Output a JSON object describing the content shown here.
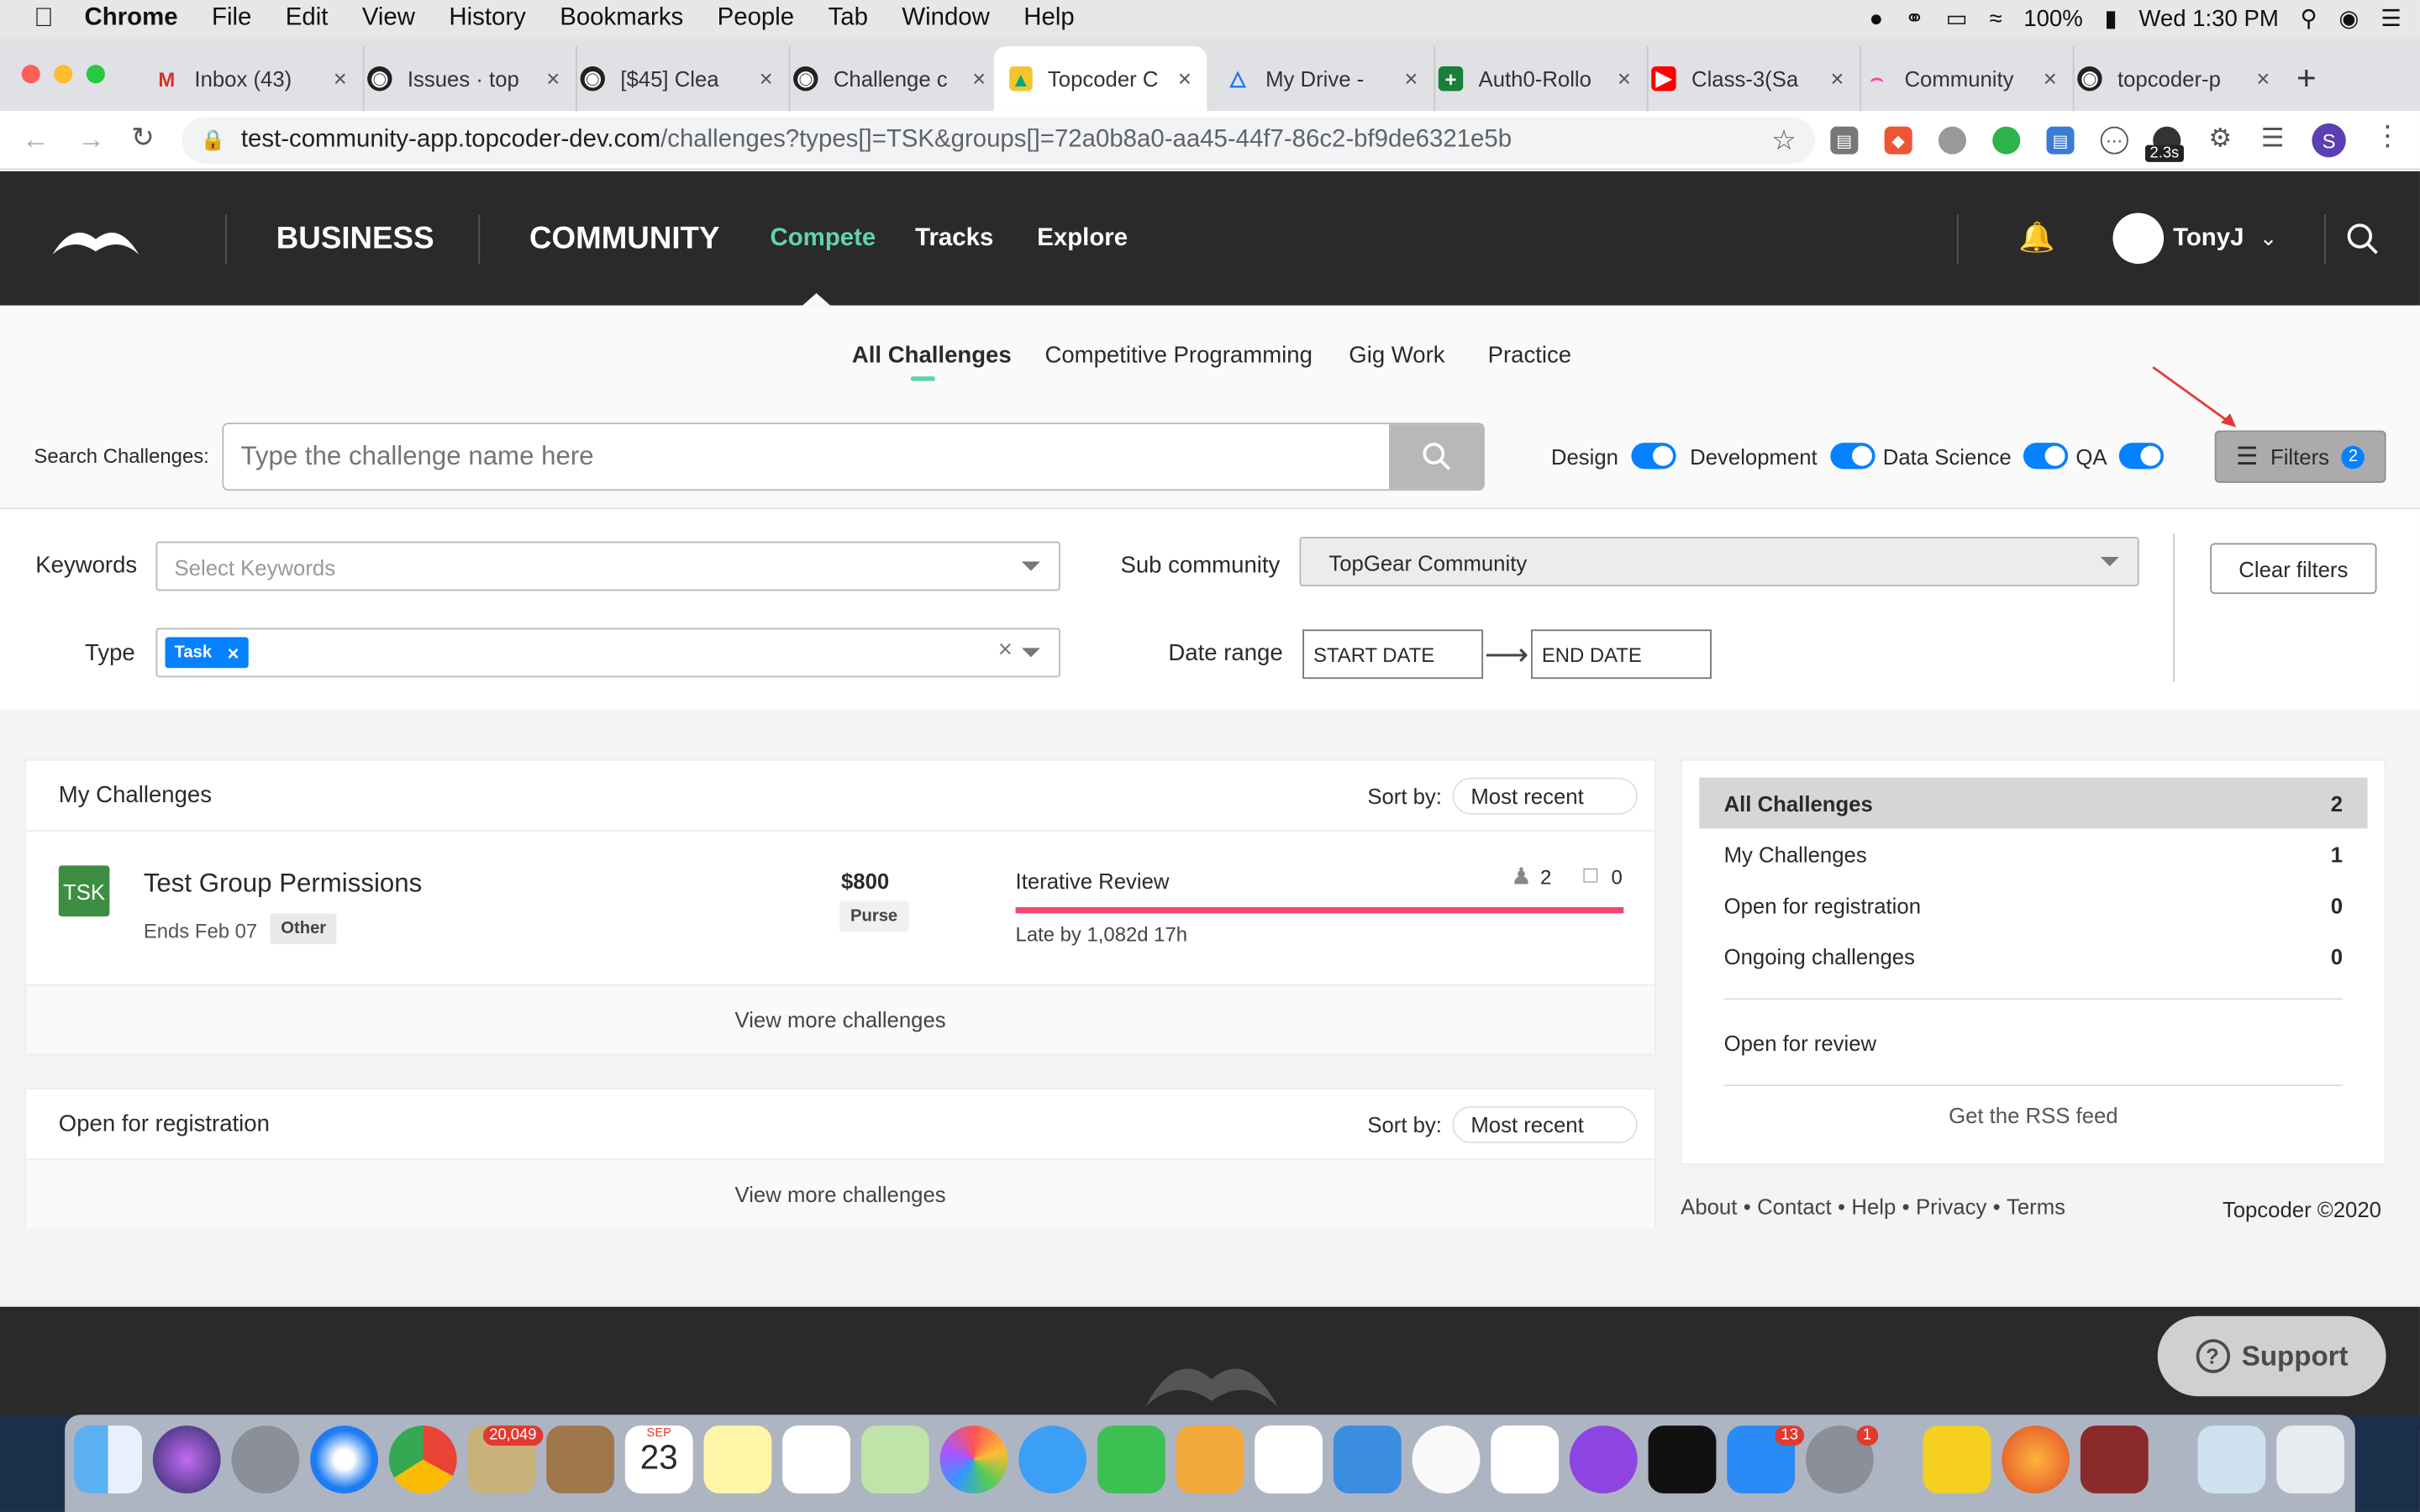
{
  "menubar": {
    "app": "Chrome",
    "items": [
      "File",
      "Edit",
      "View",
      "History",
      "Bookmarks",
      "People",
      "Tab",
      "Window",
      "Help"
    ],
    "battery": "100%",
    "clock": "Wed 1:30 PM"
  },
  "tabs": [
    {
      "label": "Inbox (43)",
      "icon": "gmail-icon"
    },
    {
      "label": "Issues · top",
      "icon": "github-icon"
    },
    {
      "label": "[$45] Clea",
      "icon": "github-icon"
    },
    {
      "label": "Challenge c",
      "icon": "github-icon"
    },
    {
      "label": "Topcoder C",
      "icon": "topcoder-icon"
    },
    {
      "label": "My Drive -",
      "icon": "drive-icon"
    },
    {
      "label": "Auth0-Rollo",
      "icon": "sheets-icon"
    },
    {
      "label": "Class-3(Sa",
      "icon": "youtube-icon"
    },
    {
      "label": "Community",
      "icon": "topcoder-icon"
    },
    {
      "label": "topcoder-p",
      "icon": "github-icon"
    }
  ],
  "address": {
    "domain": "test-community-app.topcoder-dev.com",
    "path": "/challenges?types[]=TSK&groups[]=72a0b8a0-aa45-44f7-86c2-bf9de6321e5b",
    "timer_badge": "2.3s",
    "profile_initial": "S"
  },
  "header": {
    "business": "BUSINESS",
    "community": "COMMUNITY",
    "nav": [
      "Compete",
      "Tracks",
      "Explore"
    ],
    "user": "TonyJ"
  },
  "subnav": {
    "tabs": [
      "All Challenges",
      "Competitive Programming",
      "Gig Work",
      "Practice"
    ],
    "search_label": "Search Challenges:",
    "search_placeholder": "Type the challenge name here",
    "tracks": [
      "Design",
      "Development",
      "Data Science",
      "QA"
    ],
    "filters_label": "Filters",
    "filters_count": "2"
  },
  "filters": {
    "keywords_label": "Keywords",
    "keywords_placeholder": "Select Keywords",
    "type_label": "Type",
    "type_chip": "Task",
    "subcommunity_label": "Sub community",
    "subcommunity_value": "TopGear Community",
    "date_label": "Date range",
    "start_date": "START DATE",
    "end_date": "END DATE",
    "clear": "Clear filters"
  },
  "my_challenges": {
    "title": "My Challenges",
    "sort_label": "Sort by:",
    "sort_value": "Most recent",
    "challenge": {
      "track": "TSK",
      "name": "Test Group Permissions",
      "ends": "Ends Feb 07",
      "tag": "Other",
      "prize": "$800",
      "prize_label": "Purse",
      "phase": "Iterative Review",
      "registrants": "2",
      "submissions": "0",
      "late": "Late by 1,082d 17h",
      "progress": 1.0
    },
    "view_more": "View more challenges"
  },
  "open_registration": {
    "title": "Open for registration",
    "sort_label": "Sort by:",
    "sort_value": "Most recent",
    "view_more": "View more challenges"
  },
  "sidebar": {
    "items": [
      {
        "label": "All Challenges",
        "count": "2"
      },
      {
        "label": "My Challenges",
        "count": "1"
      },
      {
        "label": "Open for registration",
        "count": "0"
      },
      {
        "label": "Ongoing challenges",
        "count": "0"
      }
    ],
    "open_review": "Open for review",
    "rss": "Get the RSS feed"
  },
  "footer": {
    "links": [
      "About",
      "Contact",
      "Help",
      "Privacy",
      "Terms"
    ],
    "copyright": "Topcoder ©2020",
    "support": "Support"
  },
  "dock": {
    "mail_badge": "20,049",
    "calendar_month": "SEP",
    "calendar_day": "23",
    "appstore_badge": "13",
    "prefs_badge": "1"
  }
}
